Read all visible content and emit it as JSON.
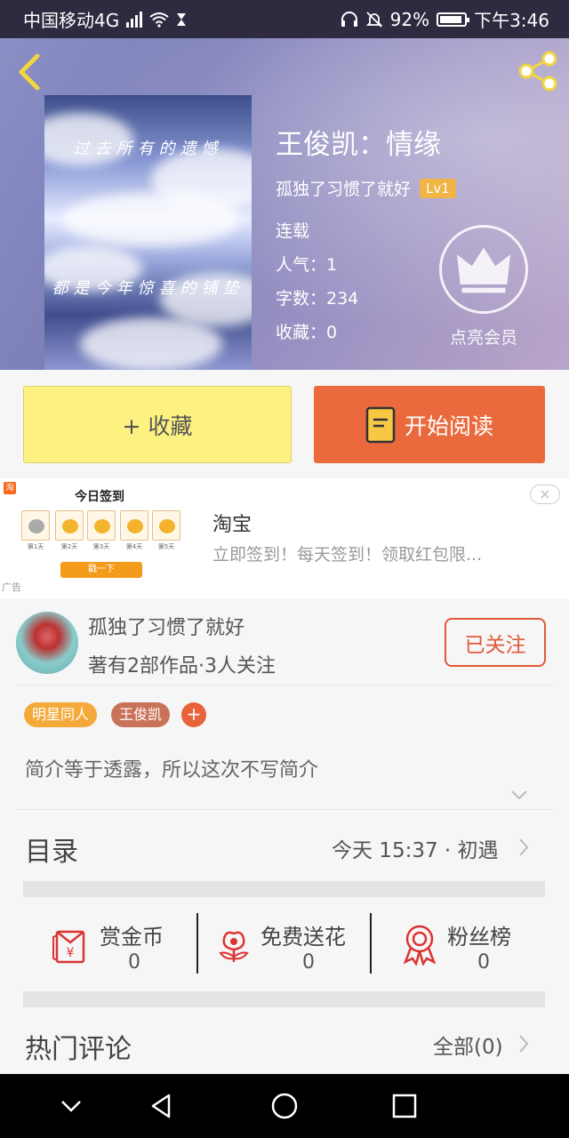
{
  "status_bar": {
    "carrier": "中国移动4G",
    "net_badge": "4G",
    "battery": "92%",
    "time": "下午3:46"
  },
  "header": {
    "book_title": "王俊凯：情缘",
    "author": "孤独了习惯了就好",
    "level": "Lv1",
    "status": "连载",
    "popularity": "人气：1",
    "word_count": "字数：234",
    "favorites": "收藏：0",
    "vip_label": "点亮会员",
    "cover_text_top": "过去所有的遗憾",
    "cover_text_bottom": "都是今年惊喜的铺垫"
  },
  "actions": {
    "favorite_label": "+ 收藏",
    "read_label": "开始阅读"
  },
  "ad": {
    "image_title": "今日签到",
    "days": [
      "第1天",
      "第2天",
      "第3天",
      "第4天",
      "第5天"
    ],
    "cta": "戳一下",
    "tag": "广告",
    "name": "淘宝",
    "description": "立即签到！每天签到！领取红包限...",
    "close": "×"
  },
  "author_card": {
    "name": "孤独了习惯了就好",
    "stats": "著有2部作品·3人关注",
    "follow_label": "已关注"
  },
  "tags": [
    {
      "label": "明星同人",
      "color": "#f4a93a"
    },
    {
      "label": "王俊凯",
      "color": "#c9725a"
    }
  ],
  "tag_add": "+",
  "intro": "简介等于透露，所以这次不写简介",
  "toc": {
    "label": "目录",
    "latest": "今天 15:37 · 初遇"
  },
  "stats": [
    {
      "label": "赏金币",
      "value": "0",
      "icon": "red-envelope-icon"
    },
    {
      "label": "免费送花",
      "value": "0",
      "icon": "flower-icon"
    },
    {
      "label": "粉丝榜",
      "value": "0",
      "icon": "medal-icon"
    }
  ],
  "comments": {
    "label": "热门评论",
    "all_label": "全部(0)"
  },
  "colors": {
    "accent": "#ea6a3d",
    "favorite_bg": "#fdf281",
    "follow": "#e05a3a"
  }
}
